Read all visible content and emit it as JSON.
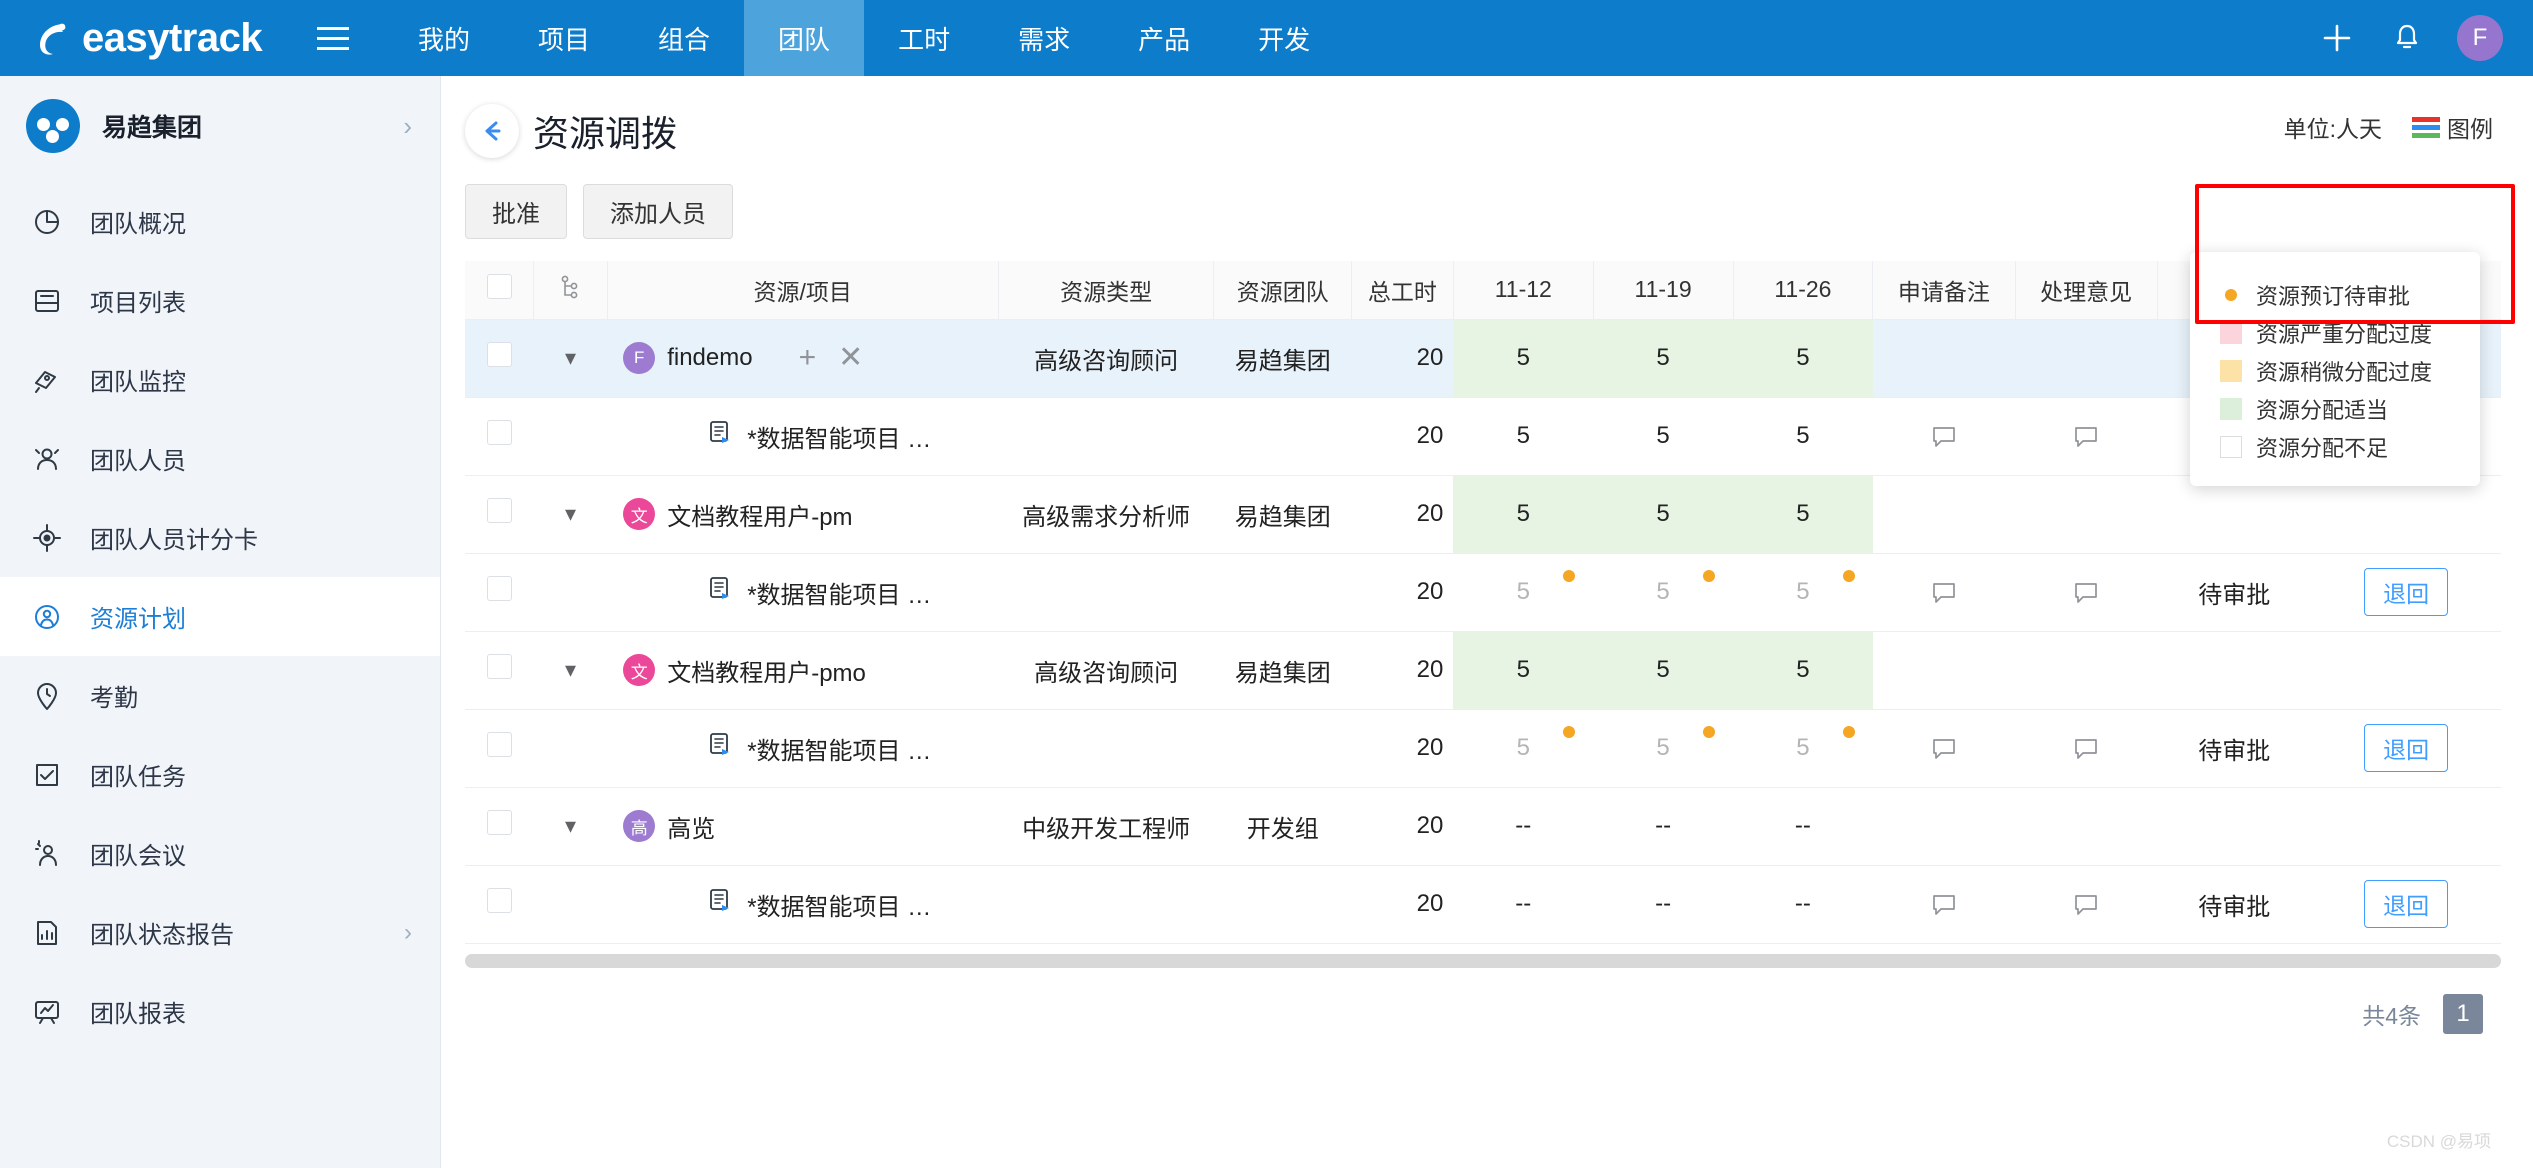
{
  "topnav": {
    "brand": "easytrack",
    "menu_icon": "hamburger-icon",
    "items": [
      {
        "label": "我的",
        "active": false
      },
      {
        "label": "项目",
        "active": false
      },
      {
        "label": "组合",
        "active": false
      },
      {
        "label": "团队",
        "active": true
      },
      {
        "label": "工时",
        "active": false
      },
      {
        "label": "需求",
        "active": false
      },
      {
        "label": "产品",
        "active": false
      },
      {
        "label": "开发",
        "active": false
      }
    ],
    "add_icon": "plus-icon",
    "bell_icon": "bell-icon",
    "avatar_initial": "F",
    "avatar_color": "#9575CD",
    "bg_color": "#0C7CCB",
    "active_color": "#4DA3DC"
  },
  "sidebar": {
    "org_name": "易趋集团",
    "org_chevron": "chevron-right-icon",
    "items": [
      {
        "label": "团队概况",
        "icon": "pie-chart-icon",
        "active": false,
        "chevron": false
      },
      {
        "label": "项目列表",
        "icon": "list-box-icon",
        "active": false,
        "chevron": false
      },
      {
        "label": "团队监控",
        "icon": "camera-monitor-icon",
        "active": false,
        "chevron": false
      },
      {
        "label": "团队人员",
        "icon": "users-icon",
        "active": false,
        "chevron": false
      },
      {
        "label": "团队人员计分卡",
        "icon": "target-icon",
        "active": false,
        "chevron": false
      },
      {
        "label": "资源计划",
        "icon": "user-circle-icon",
        "active": true,
        "chevron": false
      },
      {
        "label": "考勤",
        "icon": "clock-pin-icon",
        "active": false,
        "chevron": false
      },
      {
        "label": "团队任务",
        "icon": "checkbox-task-icon",
        "active": false,
        "chevron": false
      },
      {
        "label": "团队会议",
        "icon": "meeting-icon",
        "active": false,
        "chevron": false
      },
      {
        "label": "团队状态报告",
        "icon": "report-bar-icon",
        "active": false,
        "chevron": true
      },
      {
        "label": "团队报表",
        "icon": "chart-board-icon",
        "active": false,
        "chevron": false
      }
    ]
  },
  "page": {
    "back_icon": "arrow-left-icon",
    "title": "资源调拨",
    "buttons": [
      {
        "label": "批准",
        "name": "approve-button"
      },
      {
        "label": "添加人员",
        "name": "add-person-button"
      }
    ],
    "unit_label": "单位:人天",
    "legend_label": "图例",
    "legend_icon": "legend-stripes-icon"
  },
  "legend_popup": {
    "visible": true,
    "items": [
      {
        "label": "资源预订待审批",
        "swatch": "#F5A623",
        "shape": "dot",
        "border": "none"
      },
      {
        "label": "资源严重分配过度",
        "swatch": "#FBD4DC",
        "shape": "square",
        "border": "#FBD4DC"
      },
      {
        "label": "资源稍微分配过度",
        "swatch": "#FCE2A6",
        "shape": "square",
        "border": "#FCE2A6"
      },
      {
        "label": "资源分配适当",
        "swatch": "#DCEFDA",
        "shape": "square",
        "border": "#DCEFDA"
      },
      {
        "label": "资源分配不足",
        "swatch": "#FFFFFF",
        "shape": "square",
        "border": "#DDDDDD"
      }
    ],
    "highlight_box_color": "#FF0000"
  },
  "table": {
    "columns": [
      {
        "key": "checkbox",
        "label": "",
        "name": "select-all-checkbox-col"
      },
      {
        "key": "tree",
        "label": "",
        "name": "tree-toggle-col",
        "icon": "tree-branch-icon"
      },
      {
        "key": "resource",
        "label": "资源/项目"
      },
      {
        "key": "restype",
        "label": "资源类型"
      },
      {
        "key": "resteam",
        "label": "资源团队"
      },
      {
        "key": "total",
        "label": "总工时"
      },
      {
        "key": "w1",
        "label": "11-12"
      },
      {
        "key": "w2",
        "label": "11-19"
      },
      {
        "key": "w3",
        "label": "11-26"
      },
      {
        "key": "note",
        "label": "申请备注"
      },
      {
        "key": "opinion",
        "label": "处理意见"
      },
      {
        "key": "status",
        "label": ""
      },
      {
        "key": "action",
        "label": ""
      }
    ],
    "rows": [
      {
        "type": "parent",
        "selected": true,
        "expanded": true,
        "avatar_text": "F",
        "avatar_color": "#9C7BD1",
        "resource": "findemo",
        "restype": "高级咨询顾问",
        "resteam": "易趋集团",
        "total": "20",
        "w1": "5",
        "w2": "5",
        "w3": "5",
        "w_state": "green",
        "w_muted": false,
        "w_dots": [
          false,
          false,
          false
        ],
        "note": "",
        "opinion": "",
        "status": "",
        "action": "",
        "show_row_actions": true,
        "add_icon": "plus-icon",
        "remove_icon": "close-icon"
      },
      {
        "type": "child",
        "selected": false,
        "project_icon": "project-doc-icon",
        "resource": "*数据智能项目 …",
        "restype": "",
        "resteam": "",
        "total": "20",
        "w1": "5",
        "w2": "5",
        "w3": "5",
        "w_state": "none",
        "w_muted": false,
        "w_dots": [
          false,
          false,
          false
        ],
        "note_icon": "comment-icon",
        "opinion_icon": "comment-icon",
        "status": "",
        "action": ""
      },
      {
        "type": "parent",
        "selected": false,
        "expanded": true,
        "avatar_text": "文",
        "avatar_color": "#EC4899",
        "resource": "文档教程用户-pm",
        "restype": "高级需求分析师",
        "resteam": "易趋集团",
        "total": "20",
        "w1": "5",
        "w2": "5",
        "w3": "5",
        "w_state": "green",
        "w_muted": false,
        "w_dots": [
          false,
          false,
          false
        ],
        "note": "",
        "opinion": "",
        "status": "",
        "action": "",
        "show_row_actions": false
      },
      {
        "type": "child",
        "selected": false,
        "project_icon": "project-doc-icon",
        "resource": "*数据智能项目 …",
        "restype": "",
        "resteam": "",
        "total": "20",
        "w1": "5",
        "w2": "5",
        "w3": "5",
        "w_state": "none",
        "w_muted": true,
        "w_dots": [
          true,
          true,
          true
        ],
        "note_icon": "comment-icon",
        "opinion_icon": "comment-icon",
        "status": "待审批",
        "action": "退回"
      },
      {
        "type": "parent",
        "selected": false,
        "expanded": true,
        "avatar_text": "文",
        "avatar_color": "#EC4899",
        "resource": "文档教程用户-pmo",
        "restype": "高级咨询顾问",
        "resteam": "易趋集团",
        "total": "20",
        "w1": "5",
        "w2": "5",
        "w3": "5",
        "w_state": "green",
        "w_muted": false,
        "w_dots": [
          false,
          false,
          false
        ],
        "note": "",
        "opinion": "",
        "status": "",
        "action": "",
        "show_row_actions": false
      },
      {
        "type": "child",
        "selected": false,
        "project_icon": "project-doc-icon",
        "resource": "*数据智能项目 …",
        "restype": "",
        "resteam": "",
        "total": "20",
        "w1": "5",
        "w2": "5",
        "w3": "5",
        "w_state": "none",
        "w_muted": true,
        "w_dots": [
          true,
          true,
          true
        ],
        "note_icon": "comment-icon",
        "opinion_icon": "comment-icon",
        "status": "待审批",
        "action": "退回"
      },
      {
        "type": "parent",
        "selected": false,
        "expanded": true,
        "avatar_text": "高",
        "avatar_color": "#9C7BD1",
        "resource": "高览",
        "restype": "中级开发工程师",
        "resteam": "开发组",
        "total": "20",
        "w1": "--",
        "w2": "--",
        "w3": "--",
        "w_state": "none",
        "w_muted": false,
        "w_dots": [
          false,
          false,
          false
        ],
        "note": "",
        "opinion": "",
        "status": "",
        "action": "",
        "show_row_actions": false
      },
      {
        "type": "child",
        "selected": false,
        "project_icon": "project-doc-icon",
        "resource": "*数据智能项目 …",
        "restype": "",
        "resteam": "",
        "total": "20",
        "w1": "--",
        "w2": "--",
        "w3": "--",
        "w_state": "none",
        "w_muted": false,
        "w_dots": [
          false,
          false,
          false
        ],
        "note_icon": "comment-icon",
        "opinion_icon": "comment-icon",
        "status": "待审批",
        "action": "退回"
      }
    ]
  },
  "footer": {
    "total_text": "共4条",
    "current_page": "1"
  },
  "watermark": "CSDN @易项"
}
